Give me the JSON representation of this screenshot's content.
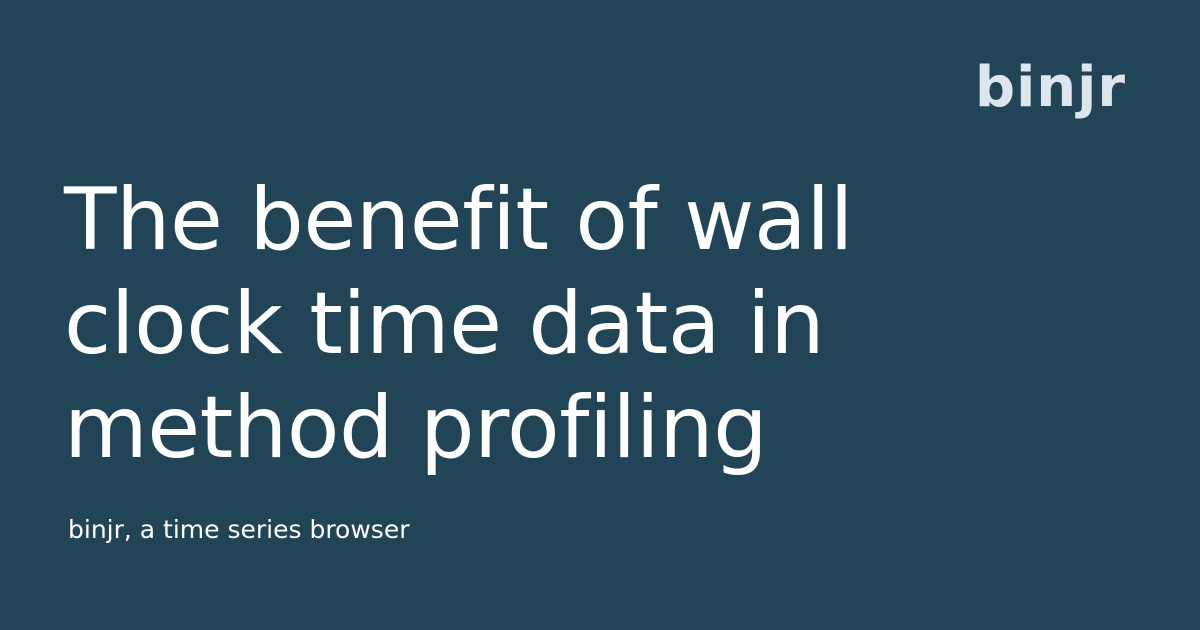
{
  "brand": {
    "logo_text": "binjr"
  },
  "headline": {
    "lines": [
      "The benefit of wall",
      "clock time data in",
      "method profiling"
    ]
  },
  "tagline": "binjr, a time series browser",
  "colors": {
    "background": "#224457",
    "headline": "#ffffff",
    "logo": "#dce6ec"
  }
}
